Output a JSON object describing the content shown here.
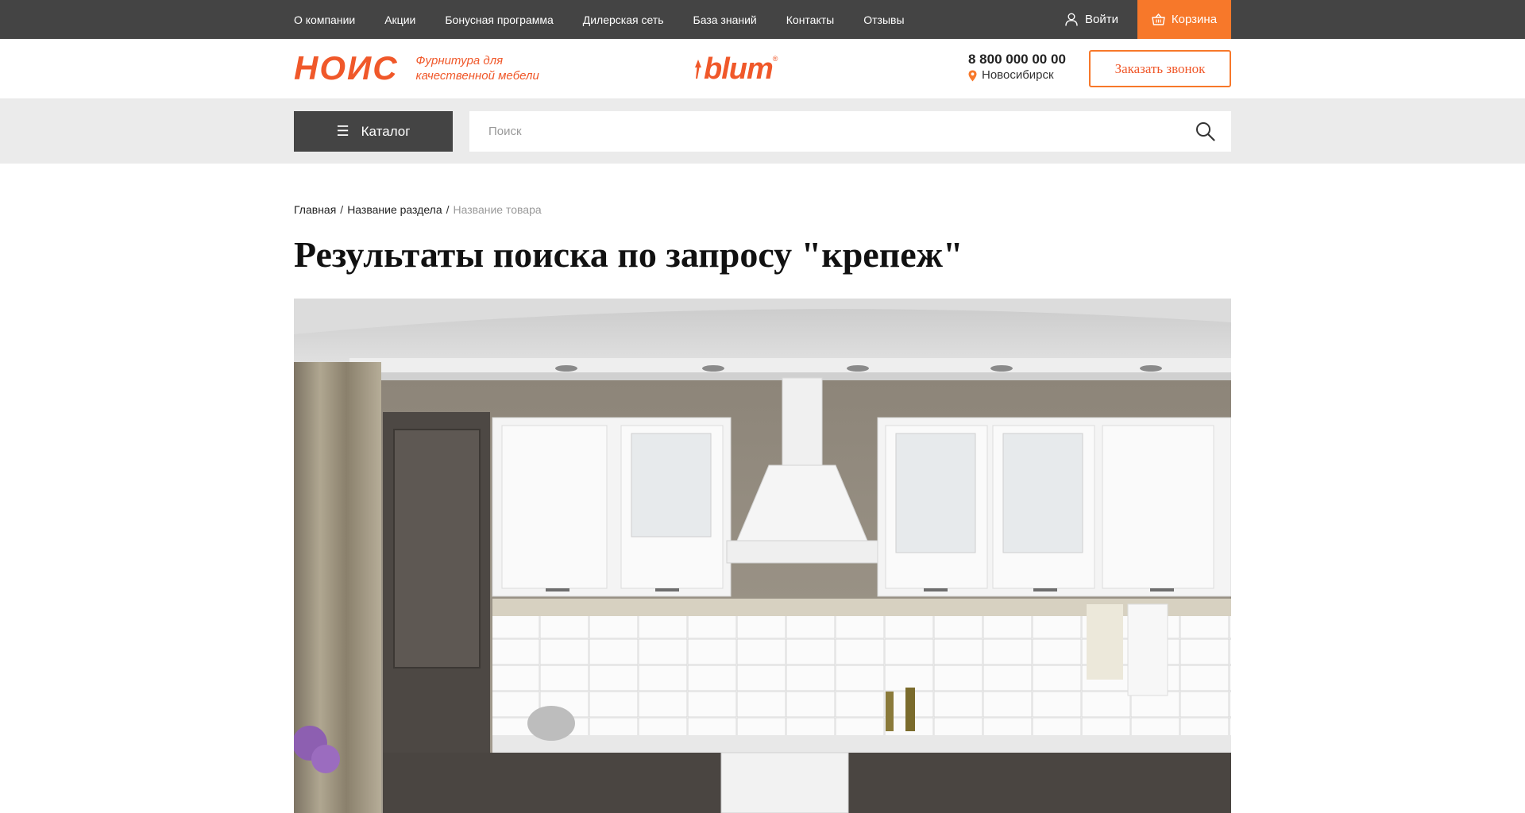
{
  "topnav": {
    "items": [
      {
        "label": "О компании"
      },
      {
        "label": "Акции"
      },
      {
        "label": "Бонусная программа"
      },
      {
        "label": "Дилерская сеть"
      },
      {
        "label": "База знаний"
      },
      {
        "label": "Контакты"
      },
      {
        "label": "Отзывы"
      }
    ],
    "login_label": "Войти",
    "cart_label": "Корзина"
  },
  "header": {
    "logo_text": "НОИС",
    "logo_tagline": "Фурнитура для качественной мебели",
    "brand_text": "blum",
    "brand_reg": "®",
    "phone": "8 800 000 00 00",
    "city": "Новосибирск",
    "callback_label": "Заказать звонок"
  },
  "searchbar": {
    "catalog_label": "Каталог",
    "placeholder": "Поиск",
    "value": ""
  },
  "breadcrumb": {
    "items": [
      "Главная",
      "Название раздела"
    ],
    "current": "Название товара",
    "separator": "/"
  },
  "page": {
    "title": "Результаты поиска по запросу \"крепеж\""
  },
  "colors": {
    "accent": "#f7782a",
    "brand_orange": "#f0582a",
    "dark": "#444444",
    "band": "#ebebeb"
  },
  "icons": {
    "login": "user-icon",
    "cart": "basket-icon",
    "location": "map-pin-icon",
    "catalog": "menu-icon",
    "search": "search-icon"
  }
}
